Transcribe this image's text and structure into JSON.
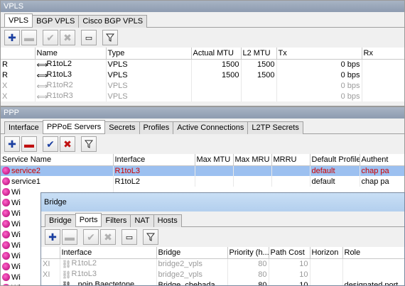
{
  "vpls_window": {
    "title": "VPLS",
    "tabs": [
      "VPLS",
      "BGP VPLS",
      "Cisco BGP VPLS"
    ],
    "columns": [
      "",
      "Name",
      "Type",
      "Actual MTU",
      "L2 MTU",
      "Tx",
      "Rx"
    ],
    "rows": [
      {
        "flag": "R",
        "name": "R1toL2",
        "type": "VPLS",
        "mtu": "1500",
        "l2mtu": "1500",
        "tx": "0 bps",
        "disabled": false
      },
      {
        "flag": "R",
        "name": "R1toL3",
        "type": "VPLS",
        "mtu": "1500",
        "l2mtu": "1500",
        "tx": "0 bps",
        "disabled": false
      },
      {
        "flag": "X",
        "name": "R1toR2",
        "type": "VPLS",
        "mtu": "",
        "l2mtu": "",
        "tx": "0 bps",
        "disabled": true
      },
      {
        "flag": "X",
        "name": "R1toR3",
        "type": "VPLS",
        "mtu": "",
        "l2mtu": "",
        "tx": "0 bps",
        "disabled": true
      }
    ]
  },
  "ppp_window": {
    "title": "PPP",
    "tabs": [
      "Interface",
      "PPPoE Servers",
      "Secrets",
      "Profiles",
      "Active Connections",
      "L2TP Secrets"
    ],
    "columns": [
      "Service Name",
      "Interface",
      "Max MTU",
      "Max MRU",
      "MRRU",
      "Default Profile",
      "Authent"
    ],
    "rows": [
      {
        "service": "service2",
        "iface": "R1toL3",
        "profile": "default",
        "auth": "chap pa",
        "selected": true
      },
      {
        "service": "service1",
        "iface": "R1toL2",
        "profile": "default",
        "auth": "chap pa",
        "selected": false
      }
    ],
    "partial_rows": [
      "Wi",
      "Wi",
      "Wi",
      "Wi",
      "Wi",
      "Wi",
      "Wi",
      "Wi",
      "Wi",
      "Wi"
    ]
  },
  "bridge_window": {
    "title": "Bridge",
    "tabs": [
      "Bridge",
      "Ports",
      "Filters",
      "NAT",
      "Hosts"
    ],
    "columns": [
      "",
      "Interface",
      "Bridge",
      "Priority (h...",
      "Path Cost",
      "Horizon",
      "Role"
    ],
    "rows": [
      {
        "flag": "XI",
        "iface": "R1toL2",
        "bridge": "bridge2_vpls",
        "priority": "80",
        "cost": "10",
        "horizon": "",
        "role": "",
        "disabled": true
      },
      {
        "flag": "XI",
        "iface": "R1toL3",
        "bridge": "bridge2_vpls",
        "priority": "80",
        "cost": "10",
        "horizon": "",
        "role": "",
        "disabled": true
      },
      {
        "flag": "",
        "iface": "...noip Baectetone",
        "bridge": "Bridge_cbebada",
        "priority": "80",
        "cost": "10",
        "horizon": "",
        "role": "designated port",
        "disabled": false
      }
    ]
  },
  "icons": {
    "add": "plus-icon",
    "remove": "minus-icon",
    "enable": "check-icon",
    "disable": "cross-icon",
    "comment": "comment-icon",
    "filter": "filter-icon"
  }
}
